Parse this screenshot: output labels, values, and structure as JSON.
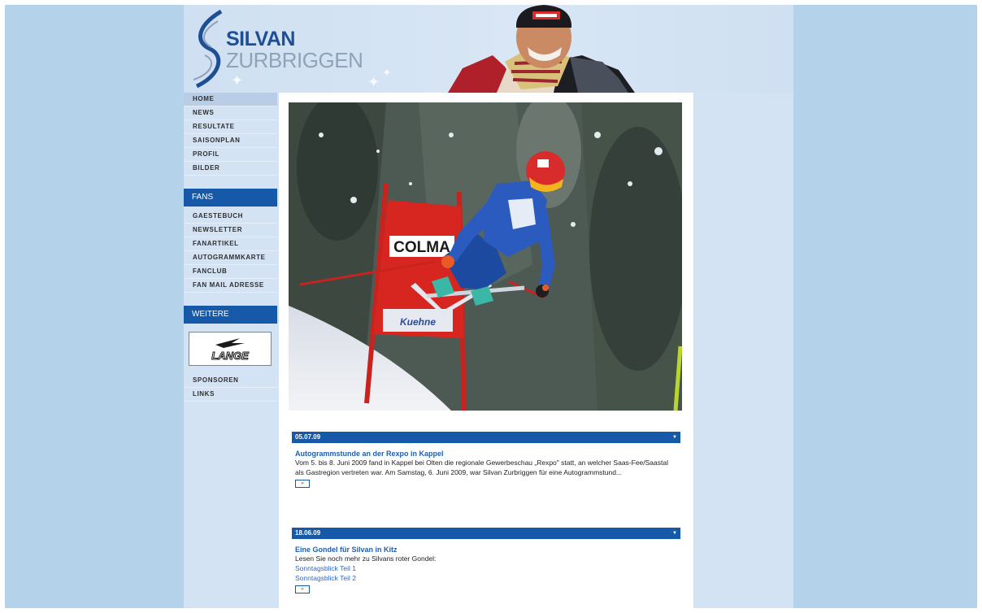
{
  "header": {
    "logo_line1": "SILVAN",
    "logo_line2": "ZURBRIGGEN",
    "logo_icon": "s-swirl-logo",
    "photo": "athlete-portrait"
  },
  "sidebar": {
    "main_nav": [
      {
        "label": "HOME"
      },
      {
        "label": "NEWS"
      },
      {
        "label": "RESULTATE"
      },
      {
        "label": "SAISONPLAN"
      },
      {
        "label": "PROFIL"
      },
      {
        "label": "BILDER"
      }
    ],
    "fans_heading": "FANS",
    "fans_nav": [
      {
        "label": "GAESTEBUCH"
      },
      {
        "label": "NEWSLETTER"
      },
      {
        "label": "FANARTIKEL"
      },
      {
        "label": "AUTOGRAMMKARTE"
      },
      {
        "label": "FANCLUB"
      },
      {
        "label": "FAN MAIL ADRESSE"
      }
    ],
    "weitere_heading": "WEITERE",
    "sponsor_logo": "LANGE",
    "weitere_nav": [
      {
        "label": "SPONSOREN"
      },
      {
        "label": "LINKS"
      }
    ]
  },
  "hero": {
    "image": "ski-racer-jump",
    "gate_banner_top": "COLMA",
    "gate_banner_bottom": "Kuehne"
  },
  "news": [
    {
      "date": "05.07.09",
      "title": "Autogrammstunde an der Rexpo in Kappel",
      "text": "Vom 5. bis 8. Juni 2009 fand in Kappel bei Olten die regionale Gewerbeschau „Rexpo\" statt, an welcher Saas-Fee/Saastal als Gastregion vertreten war. Am Samstag, 6. Juni 2009, war Silvan Zurbriggen für eine Autogrammstund...",
      "links": [],
      "more": "»"
    },
    {
      "date": "18.06.09",
      "title": "Eine Gondel für Silvan in Kitz",
      "text": "Lesen Sie noch mehr zu Silvans roter Gondel:",
      "links": [
        "Sonntagsblick Teil 1",
        "Sonntagsblick Teil 2"
      ],
      "more": "»"
    }
  ],
  "colors": {
    "outer_background": "#b5d2eb",
    "page_background": "#d4e3f4",
    "accent_blue": "#1559a8",
    "link_blue": "#2f67c0",
    "logo_blue": "#1e4f96"
  }
}
